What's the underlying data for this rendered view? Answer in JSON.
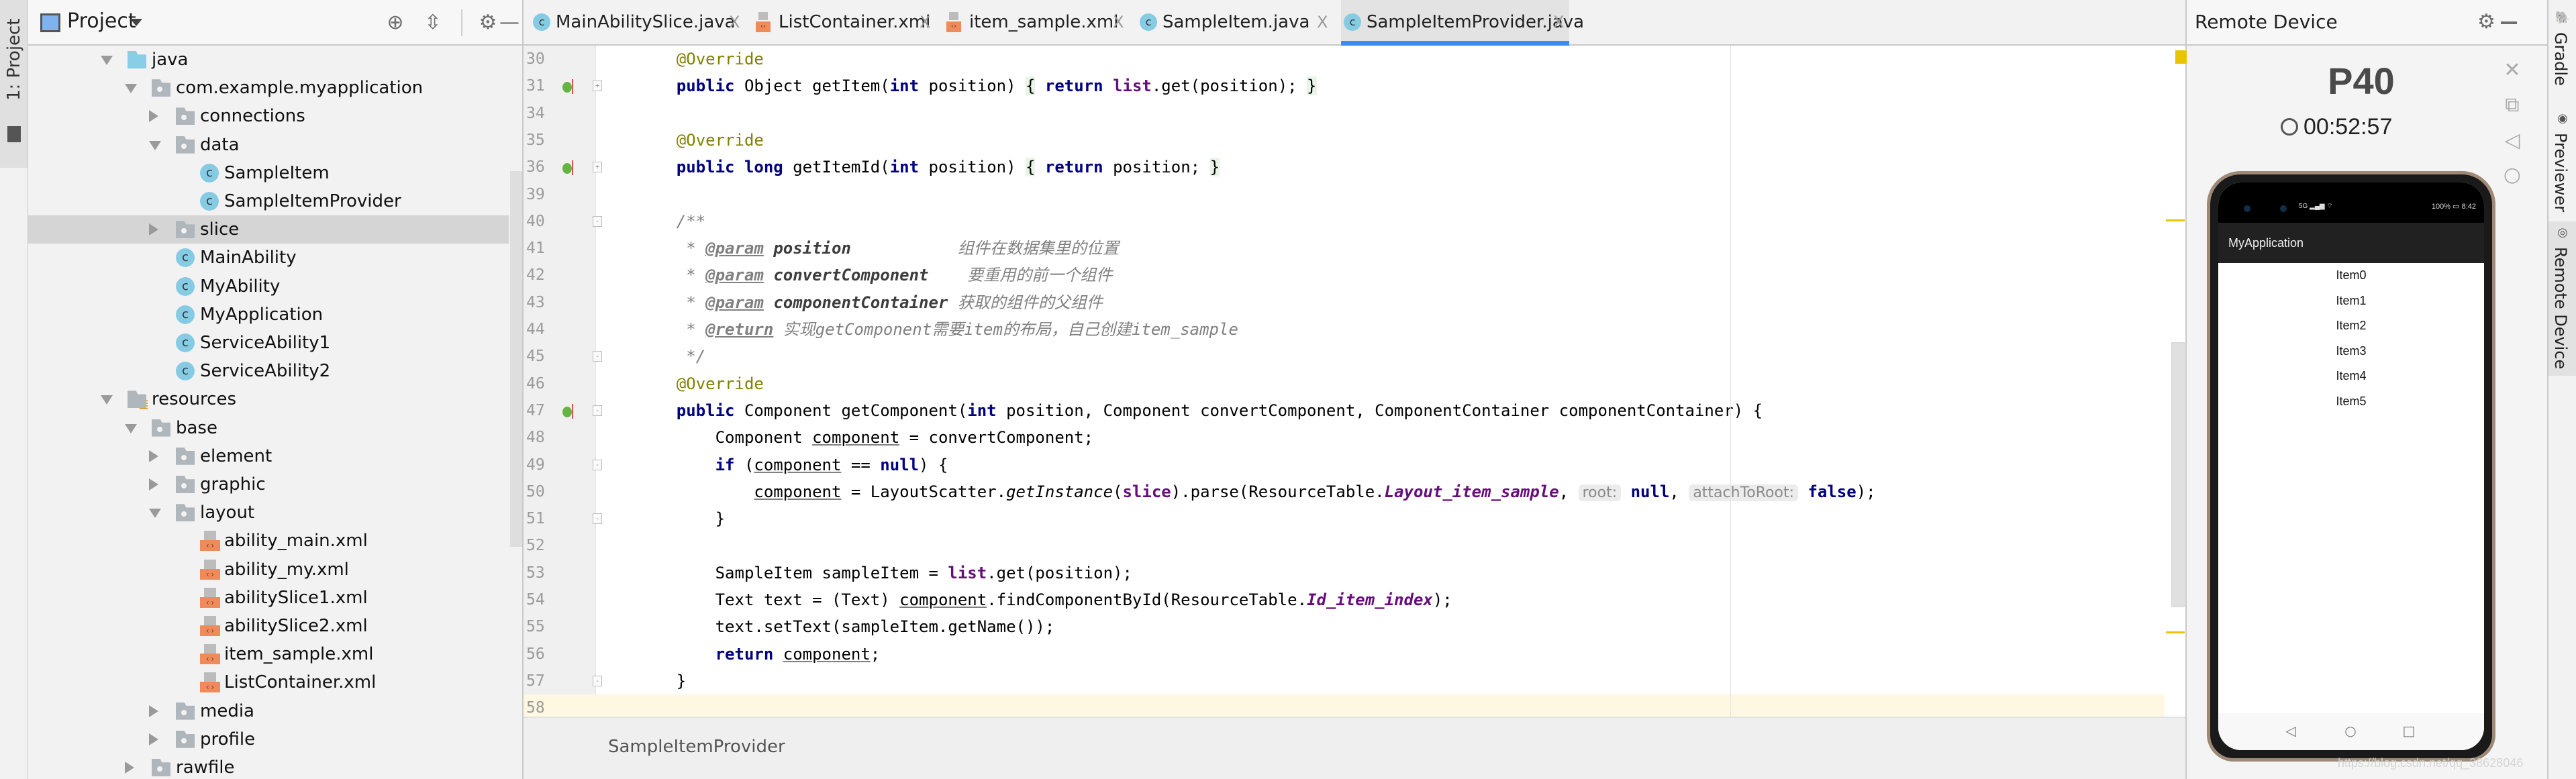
{
  "left_strip": {
    "project_tab": "1: Project"
  },
  "project_panel": {
    "title": "Project",
    "header_icons": [
      "locate-icon",
      "collapse-all-icon",
      "gear-icon",
      "minimize-icon"
    ],
    "tree": [
      {
        "label": "java",
        "depth": 0,
        "icon": "folder-blue",
        "expanded": true
      },
      {
        "label": "com.example.myapplication",
        "depth": 1,
        "icon": "package",
        "expanded": true
      },
      {
        "label": "connections",
        "depth": 2,
        "icon": "package",
        "expanded": false
      },
      {
        "label": "data",
        "depth": 2,
        "icon": "package",
        "expanded": true
      },
      {
        "label": "SampleItem",
        "depth": 3,
        "icon": "class"
      },
      {
        "label": "SampleItemProvider",
        "depth": 3,
        "icon": "class"
      },
      {
        "label": "slice",
        "depth": 2,
        "icon": "package",
        "expanded": false,
        "selected": true
      },
      {
        "label": "MainAbility",
        "depth": 2,
        "icon": "class"
      },
      {
        "label": "MyAbility",
        "depth": 2,
        "icon": "class"
      },
      {
        "label": "MyApplication",
        "depth": 2,
        "icon": "class"
      },
      {
        "label": "ServiceAbility1",
        "depth": 2,
        "icon": "class"
      },
      {
        "label": "ServiceAbility2",
        "depth": 2,
        "icon": "class"
      },
      {
        "label": "resources",
        "depth": 0,
        "icon": "folder-res",
        "expanded": true
      },
      {
        "label": "base",
        "depth": 1,
        "icon": "package",
        "expanded": true
      },
      {
        "label": "element",
        "depth": 2,
        "icon": "package",
        "expanded": false
      },
      {
        "label": "graphic",
        "depth": 2,
        "icon": "package",
        "expanded": false
      },
      {
        "label": "layout",
        "depth": 2,
        "icon": "package",
        "expanded": true
      },
      {
        "label": "ability_main.xml",
        "depth": 3,
        "icon": "xml"
      },
      {
        "label": "ability_my.xml",
        "depth": 3,
        "icon": "xml"
      },
      {
        "label": "abilitySlice1.xml",
        "depth": 3,
        "icon": "xml"
      },
      {
        "label": "abilitySlice2.xml",
        "depth": 3,
        "icon": "xml"
      },
      {
        "label": "item_sample.xml",
        "depth": 3,
        "icon": "xml"
      },
      {
        "label": "ListContainer.xml",
        "depth": 3,
        "icon": "xml"
      },
      {
        "label": "media",
        "depth": 2,
        "icon": "package",
        "expanded": false
      },
      {
        "label": "profile",
        "depth": 2,
        "icon": "package",
        "expanded": false
      },
      {
        "label": "rawfile",
        "depth": 1,
        "icon": "package",
        "expanded": false
      }
    ]
  },
  "editor": {
    "tabs": [
      {
        "label": "MainAbilitySlice.java",
        "icon": "class",
        "active": false
      },
      {
        "label": "ListContainer.xml",
        "icon": "xml",
        "active": false
      },
      {
        "label": "item_sample.xml",
        "icon": "xml",
        "active": false
      },
      {
        "label": "SampleItem.java",
        "icon": "class",
        "active": false
      },
      {
        "label": "SampleItemProvider.java",
        "icon": "class",
        "active": true
      }
    ],
    "tab_close_glyph": "X",
    "lines": [
      {
        "num": "30",
        "text": "    @Override"
      },
      {
        "num": "31",
        "text": "    public Object getItem(int position) { return list.get(position); }"
      },
      {
        "num": "34",
        "text": ""
      },
      {
        "num": "35",
        "text": "    @Override"
      },
      {
        "num": "36",
        "text": "    public long getItemId(int position) { return position; }"
      },
      {
        "num": "39",
        "text": ""
      },
      {
        "num": "40",
        "text": "    /**"
      },
      {
        "num": "41",
        "text": "     * @param position           组件在数据集里的位置"
      },
      {
        "num": "42",
        "text": "     * @param convertComponent    要重用的前一个组件"
      },
      {
        "num": "43",
        "text": "     * @param componentContainer 获取的组件的父组件"
      },
      {
        "num": "44",
        "text": "     * @return 实现getComponent需要item的布局，自己创建item_sample"
      },
      {
        "num": "45",
        "text": "     */"
      },
      {
        "num": "46",
        "text": "    @Override"
      },
      {
        "num": "47",
        "text": "    public Component getComponent(int position, Component convertComponent, ComponentContainer componentContainer) {"
      },
      {
        "num": "48",
        "text": "        Component component = convertComponent;"
      },
      {
        "num": "49",
        "text": "        if (component == null) {"
      },
      {
        "num": "50",
        "text": "            component = LayoutScatter.getInstance(slice).parse(ResourceTable.Layout_item_sample, root: null, attachToRoot: false);"
      },
      {
        "num": "51",
        "text": "        }"
      },
      {
        "num": "52",
        "text": ""
      },
      {
        "num": "53",
        "text": "        SampleItem sampleItem = list.get(position);"
      },
      {
        "num": "54",
        "text": "        Text text = (Text) component.findComponentById(ResourceTable.Id_item_index);"
      },
      {
        "num": "55",
        "text": "        text.setText(sampleItem.getName());"
      },
      {
        "num": "56",
        "text": "        return component;"
      },
      {
        "num": "57",
        "text": "    }"
      },
      {
        "num": "58",
        "text": ""
      }
    ],
    "current_line": "58",
    "breadcrumb": "SampleItemProvider",
    "colors": {
      "keyword": "#000080",
      "annotation": "#808000",
      "field": "#660e7a",
      "comment": "#808080",
      "current_line_bg": "#fef8e2",
      "warning_marker": "#e9c400",
      "active_tab_underline": "#3a8ef0"
    }
  },
  "remote_device": {
    "title": "Remote Device",
    "device_name": "P40",
    "timer": "00:52:57",
    "controls": [
      "close-icon",
      "rotate-icon",
      "back-icon",
      "home-icon"
    ],
    "phone": {
      "status_signal": "5G",
      "battery": "100%",
      "clock": "8:42",
      "app_title": "MyApplication",
      "items": [
        "Item0",
        "Item1",
        "Item2",
        "Item3",
        "Item4",
        "Item5"
      ],
      "nav": [
        "back",
        "home",
        "recents"
      ]
    },
    "watermark": "https://blog.csdn.net/qq_38628046"
  },
  "right_strip": {
    "tabs": [
      {
        "label": "Gradle",
        "icon": "gradle-icon"
      },
      {
        "label": "Previewer",
        "icon": "eye-icon"
      },
      {
        "label": "Remote Device",
        "icon": "remote-device-icon",
        "active": true
      }
    ]
  }
}
